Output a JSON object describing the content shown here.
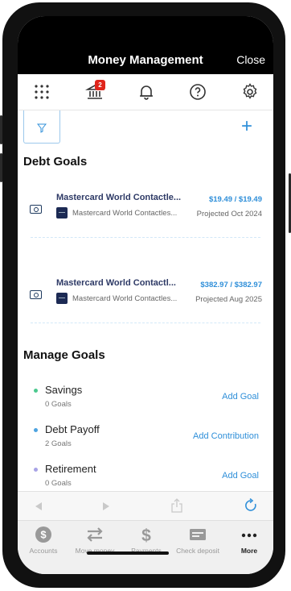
{
  "header": {
    "title": "Money Management",
    "close_label": "Close"
  },
  "iconbar": {
    "icons": [
      "apps-grid-icon",
      "bank-icon",
      "bell-icon",
      "help-icon",
      "settings-icon"
    ],
    "bank_badge": "2"
  },
  "debt_goals": {
    "heading": "Debt Goals",
    "items": [
      {
        "name": "Mastercard World Contactle...",
        "account": "Mastercard World Contactles...",
        "amount": "$19.49 / $19.49",
        "projected": "Projected Oct 2024"
      },
      {
        "name": "Mastercard World Contactl...",
        "account": "Mastercard World Contactles...",
        "amount": "$382.97 / $382.97",
        "projected": "Projected Aug 2025"
      }
    ]
  },
  "manage_goals": {
    "heading": "Manage Goals",
    "items": [
      {
        "name": "Savings",
        "count": "0 Goals",
        "action": "Add Goal",
        "dot_color": "#4cc98f"
      },
      {
        "name": "Debt Payoff",
        "count": "2 Goals",
        "action": "Add Contribution",
        "dot_color": "#4da3e0"
      },
      {
        "name": "Retirement",
        "count": "0 Goals",
        "action": "Add Goal",
        "dot_color": "#a8a3e6"
      }
    ]
  },
  "tabs": [
    {
      "label": "Accounts",
      "icon": "dollar-circle-icon"
    },
    {
      "label": "Move money",
      "icon": "transfer-arrows-icon"
    },
    {
      "label": "Payments",
      "icon": "dollar-sign-icon"
    },
    {
      "label": "Check deposit",
      "icon": "check-card-icon"
    },
    {
      "label": "More",
      "icon": "more-dots-icon"
    }
  ],
  "colors": {
    "accent": "#2f8fd9",
    "header_bg": "#000000",
    "badge": "#e0251b"
  }
}
